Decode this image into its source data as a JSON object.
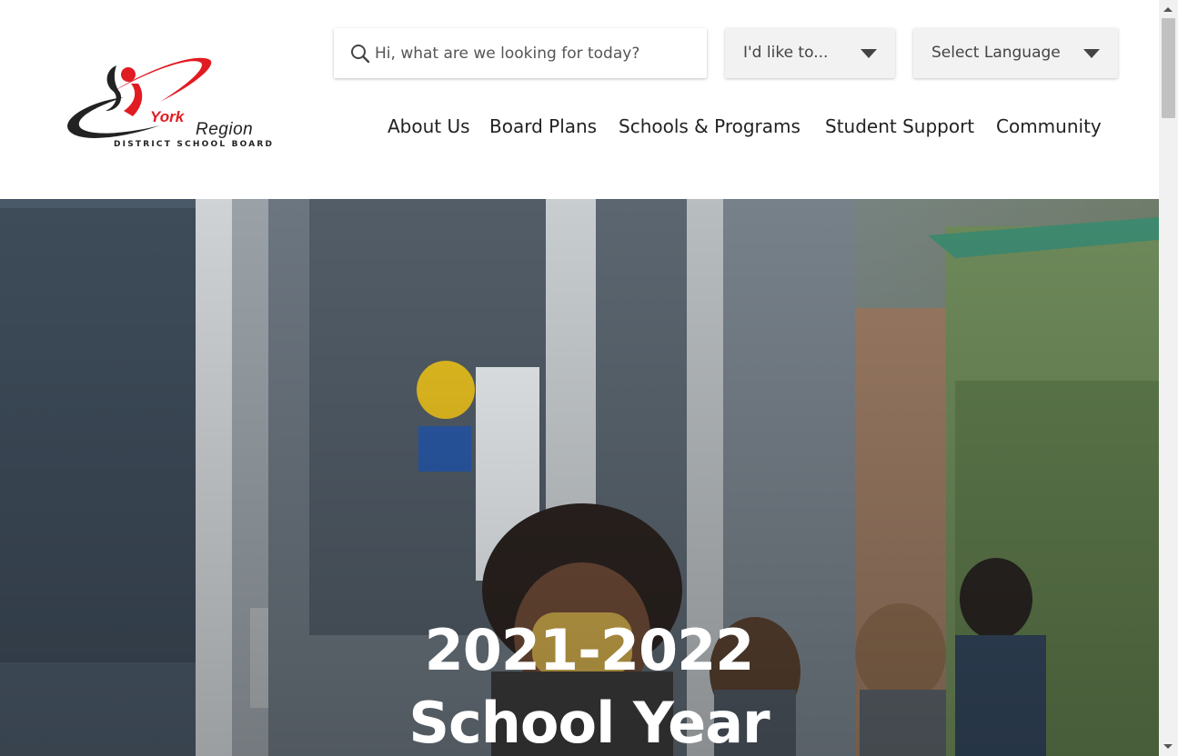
{
  "brand": {
    "york": "York",
    "region": "Region",
    "board": "DISTRICT SCHOOL BOARD",
    "colors": {
      "red": "#e11b22",
      "dark": "#222222"
    }
  },
  "search": {
    "placeholder": "Hi, what are we looking for today?",
    "value": ""
  },
  "quick_links": {
    "label": "I'd like to..."
  },
  "language": {
    "label": "Select Language"
  },
  "nav": [
    {
      "label": "About Us"
    },
    {
      "label": "Board Plans"
    },
    {
      "label": "Schools & Programs"
    },
    {
      "label": "Student Support"
    },
    {
      "label": "Community"
    }
  ],
  "hero": {
    "line1": "2021-2022",
    "line2": "School Year",
    "image": "students-wearing-masks-at-school-entrance"
  },
  "scrollbar": {
    "icons": [
      "scroll-up-arrow-icon",
      "scroll-down-arrow-icon"
    ]
  }
}
